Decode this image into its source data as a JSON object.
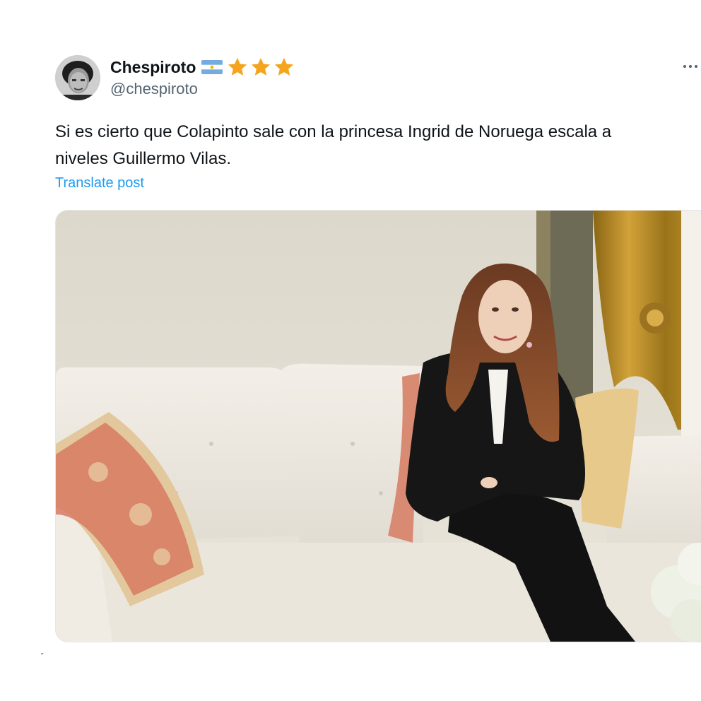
{
  "author": {
    "display_name": "Chespiroto",
    "handle": "@chespiroto",
    "badges": [
      "argentina-flag-icon",
      "star-icon",
      "star-icon",
      "star-icon"
    ],
    "star_color": "#f4a41d"
  },
  "post": {
    "text_line1": "Si es cierto que Colapinto sale con la princesa Ingrid de Noruega escala a",
    "text_line2": "niveles Guillermo Vilas.",
    "translate_label": "Translate post",
    "link_color": "#1d9bf0"
  },
  "media": {
    "subject": "photo-woman-seated-on-white-sofa"
  },
  "footer_mark": "\""
}
